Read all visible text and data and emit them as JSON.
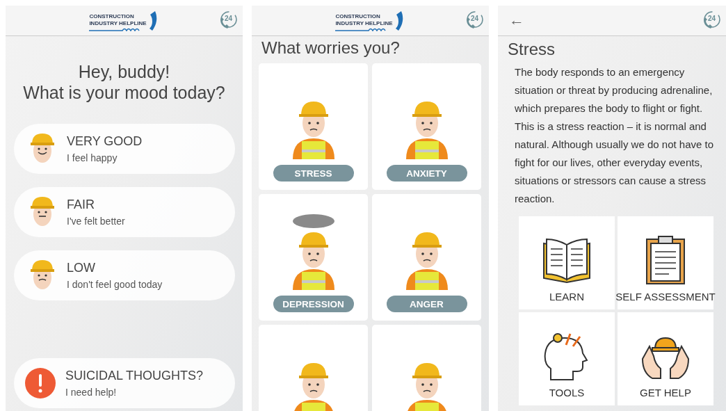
{
  "mood_screen": {
    "logo": {
      "line_1": "CONSTRUCTION",
      "line_2": "INDUSTRY HELPLINE"
    },
    "hotline_badge": "24",
    "greeting": "Hey, buddy!",
    "question": "What is your mood today?",
    "moods": [
      {
        "kind": "happy",
        "label": "VERY GOOD",
        "caption": "I feel happy"
      },
      {
        "kind": "neutral",
        "label": "FAIR",
        "caption": "I've felt better"
      },
      {
        "kind": "sad",
        "label": "LOW",
        "caption": "I don't feel good today"
      },
      {
        "kind": "alert",
        "label": "SUICIDAL THOUGHTS?",
        "caption": "I need help!"
      }
    ]
  },
  "worries_screen": {
    "logo": {
      "line_1": "CONSTRUCTION",
      "line_2": "INDUSTRY HELPLINE"
    },
    "hotline_badge": "24",
    "title": "What worries you?",
    "worries": [
      {
        "kind": "plain",
        "label": "STRESS"
      },
      {
        "kind": "plain",
        "label": "ANXIETY"
      },
      {
        "kind": "cloud",
        "label": "DEPRESSION"
      },
      {
        "kind": "plain",
        "label": "ANGER"
      },
      {
        "kind": "plain"
      },
      {
        "kind": "plain"
      }
    ]
  },
  "stress_screen": {
    "back": "←",
    "hotline_badge": "24",
    "title": "Stress",
    "body": "The body responds to an emergency situation or threat by producing adrenaline, which prepares the body to flight or fight. This is a stress reaction – it is normal and natural. Although usually we do not have to fight for our lives, other everyday events, situations or stressors can cause a stress reaction.",
    "tiles": [
      {
        "kind": "book",
        "label": "LEARN"
      },
      {
        "kind": "clipboard",
        "label": "SELF ASSESSMENT"
      },
      {
        "kind": "head",
        "label": "TOOLS"
      },
      {
        "kind": "hands",
        "label": "GET HELP"
      }
    ]
  }
}
